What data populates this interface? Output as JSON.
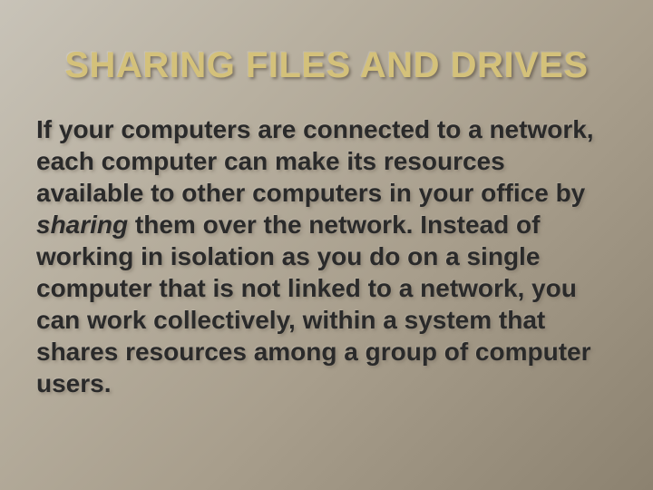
{
  "title": "SHARING FILES AND DRIVES",
  "body_pre": "If your computers are connected to a network, each computer can make its resources available to other computers in your office by ",
  "body_em": "sharing",
  "body_post": " them over the network. Instead of working in isolation as you do on a single computer that is not linked to a network, you can work collectively, within a system that shares resources among a group of computer users."
}
